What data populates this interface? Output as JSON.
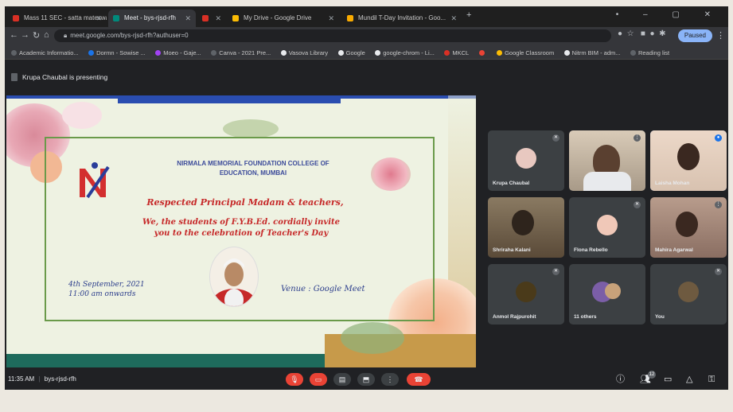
{
  "browser": {
    "tabs": [
      {
        "label": "Mass 11 SEC - satta mateswad - ...",
        "active": false,
        "fav_color": "#d93025"
      },
      {
        "label": "Meet - bys-rjsd-rfh",
        "active": true,
        "fav_color": "#00897b"
      },
      {
        "label": "",
        "active": false,
        "fav_color": "#d93025"
      },
      {
        "label": "My Drive - Google Drive",
        "active": false,
        "fav_color": "#fbbc04"
      },
      {
        "label": "Mundil T-Day Invitation - Goo...",
        "active": false,
        "fav_color": "#f9ab00"
      }
    ],
    "window_controls": "•  –  ▢  ✕",
    "url": "meet.google.com/bys-rjsd-rfh?authuser=0",
    "profile_label": "Paused",
    "bookmarks": [
      {
        "label": "Academic Informatio...",
        "color": "#5f6368"
      },
      {
        "label": "Dormn - Sowise ...",
        "color": "#1a73e8"
      },
      {
        "label": "Moeo - Gaje...",
        "color": "#a142f4"
      },
      {
        "label": "Canva - 2021 Pre...",
        "color": "#5f6368"
      },
      {
        "label": "Vasova Library",
        "color": "#e8eaed"
      },
      {
        "label": "Google",
        "color": "#e8eaed"
      },
      {
        "label": "google-chrom - Li...",
        "color": "#e8eaed"
      },
      {
        "label": "MKCL",
        "color": "#d93025"
      },
      {
        "label": "",
        "color": "#ea4335"
      },
      {
        "label": "Google Classroom",
        "color": "#fbbc04"
      },
      {
        "label": "Nitrm BIM - adm...",
        "color": "#e8eaed"
      },
      {
        "label": "Reading list",
        "color": "#5f6368"
      }
    ]
  },
  "meet": {
    "presenting_text": "Krupa Chaubal is presenting",
    "meeting_time": "11:35 AM",
    "meeting_code": "bys-rjsd-rfh",
    "participants": [
      {
        "name": "Krupa Chaubal",
        "type": "avatar",
        "color": "#e8c8c0"
      },
      {
        "name": "",
        "type": "video",
        "color": "#d9cbb8"
      },
      {
        "name": "Laisha Mohan",
        "type": "video",
        "color": "#ecd8c8"
      },
      {
        "name": "Shriraha Kalani",
        "type": "video",
        "color": "#6b5a48"
      },
      {
        "name": "Flona Rebello",
        "type": "avatar",
        "color": "#f0c8b8"
      },
      {
        "name": "Mahira Agarwal",
        "type": "video",
        "color": "#b89c8c"
      },
      {
        "name": "Anmol Rajpurohit",
        "type": "avatar",
        "color": "#4a3a1a"
      },
      {
        "name": "11 others",
        "type": "avatar",
        "color": "#7b5ea7"
      },
      {
        "name": "You",
        "type": "avatar",
        "color": "#6e5a40"
      }
    ],
    "participant_count": "12"
  },
  "slide": {
    "college_name_line1": "NIRMALA MEMORIAL FOUNDATION COLLEGE OF",
    "college_name_line2": "EDUCATION, MUMBAI",
    "greeting": "Respected Principal Madam & teachers,",
    "invite_line1": "We, the students of F.Y.B.Ed. cordially invite",
    "invite_line2": "you to the celebration of Teacher's Day",
    "date_line1": "4th September, 2021",
    "date_line2": "11:00 am onwards",
    "venue": "Venue : Google Meet"
  }
}
